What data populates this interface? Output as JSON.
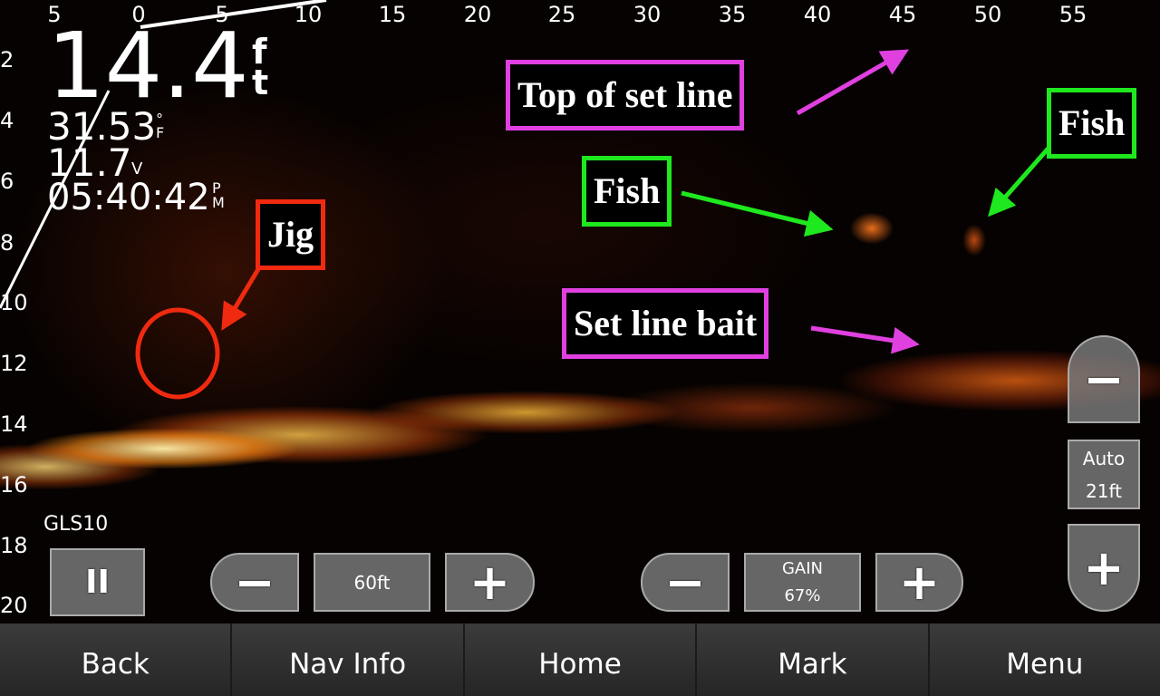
{
  "top_scale": [
    "5",
    "0",
    "5",
    "10",
    "15",
    "20",
    "25",
    "30",
    "35",
    "40",
    "45",
    "50",
    "55"
  ],
  "depth_scale": [
    "2",
    "4",
    "6",
    "8",
    "10",
    "12",
    "14",
    "16",
    "18",
    "20"
  ],
  "readouts": {
    "depth": "14.4",
    "depth_unit": "ft",
    "temp": "31.53",
    "temp_unit": "°F",
    "voltage": "11.7",
    "voltage_unit": "V",
    "time": "05:40:42",
    "time_unit": "PM"
  },
  "source": "GLS10",
  "annotations": {
    "top_set_line": "Top of set line",
    "fish1": "Fish",
    "fish2": "Fish",
    "jig": "Jig",
    "set_line_bait": "Set line bait"
  },
  "controls": {
    "range_value": "60ft",
    "gain_label": "GAIN",
    "gain_value": "67%",
    "depth_mode": "Auto",
    "depth_value": "21ft",
    "minus": "−",
    "plus": "+",
    "pause": "II"
  },
  "colors": {
    "pink": "#e040e0",
    "green": "#1ee81e",
    "red": "#f02a10"
  },
  "nav": [
    "Back",
    "Nav Info",
    "Home",
    "Mark",
    "Menu"
  ]
}
